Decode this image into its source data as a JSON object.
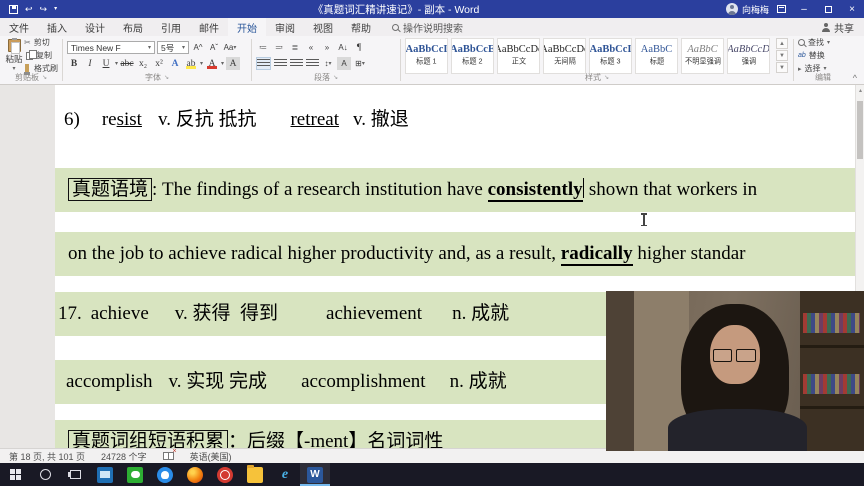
{
  "title_bar": {
    "title": "《真题词汇精讲速记》- 副本 - Word",
    "user": "向梅梅"
  },
  "menu": {
    "tabs": [
      "文件",
      "插入",
      "设计",
      "布局",
      "引用",
      "邮件",
      "开始",
      "审阅",
      "视图",
      "帮助"
    ],
    "active_tab": "开始",
    "search_label": "操作说明搜索",
    "share": "共享"
  },
  "ribbon": {
    "clipboard": {
      "label": "剪贴板",
      "paste": "粘贴",
      "cut": "剪切",
      "copy": "复制",
      "format_painter": "格式刷"
    },
    "font": {
      "label": "字体",
      "name": "Times New F",
      "size": "5号"
    },
    "paragraph": {
      "label": "段落"
    },
    "styles": {
      "label": "样式",
      "items": [
        {
          "sample": "AaBbCcI",
          "name": "标题 1"
        },
        {
          "sample": "AaBbCcE",
          "name": "标题 2"
        },
        {
          "sample": "AaBbCcDc",
          "name": "正文"
        },
        {
          "sample": "AaBbCcDc",
          "name": "无间隔"
        },
        {
          "sample": "AaBbCcI",
          "name": "标题 3"
        },
        {
          "sample": "AaBbC",
          "name": "标题"
        },
        {
          "sample": "AaBbC",
          "name": "不明显强调"
        },
        {
          "sample": "AaBbCcD",
          "name": "强调"
        }
      ]
    },
    "editing": {
      "label": "编辑",
      "find": "查找",
      "replace": "替换",
      "select": "选择"
    }
  },
  "document": {
    "line1": {
      "num": "6)",
      "word_a1": "re",
      "word_a2": "sist",
      "def_a": "v. 反抗 抵抗",
      "word_b": "retreat",
      "def_b": "v. 撤退"
    },
    "line2": {
      "tag": "真题语境",
      "pre": ": The findings of a research institution have ",
      "keyword": "consistently",
      "post": " shown that workers in"
    },
    "line3": {
      "pre": "on the job to achieve radical higher productivity and, as a result, ",
      "keyword": "radically",
      "post": " higher standar"
    },
    "line4": {
      "num": "17.",
      "word_a": "achieve",
      "def_a": "v. 获得  得到",
      "word_b": "achievement",
      "def_b": "n. 成就"
    },
    "line5": {
      "word_a": "accomplish",
      "def_a": "v. 实现 完成",
      "word_b": "accomplishment",
      "def_b": "n. 成就"
    },
    "line6": {
      "tag": "真题词组短语积累",
      "rest": "：后缀【-ment】名词词性"
    }
  },
  "status_bar": {
    "page": "第 18 页, 共 101 页",
    "words": "24728 个字",
    "language": "英语(美国)"
  },
  "taskbar": {
    "icons": [
      "start",
      "cortana-search",
      "task-view",
      "monitor-app",
      "wechat",
      "tim-chat",
      "firefox",
      "netease-music",
      "file-explorer",
      "ie-browser",
      "word-active"
    ]
  }
}
